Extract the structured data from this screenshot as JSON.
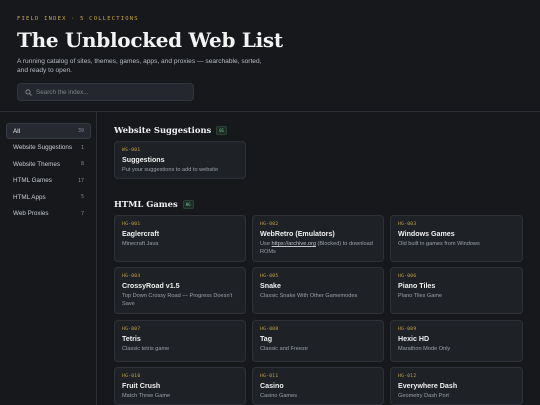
{
  "header": {
    "eyebrow": "FIELD INDEX · 5 COLLECTIONS",
    "title": "The Unblocked Web List",
    "subtitle": "A running catalog of sites, themes, games, apps, and proxies — searchable, sorted, and ready to open."
  },
  "search": {
    "placeholder": "Search the index..."
  },
  "sidebar": {
    "items": [
      {
        "label": "All",
        "count": "39"
      },
      {
        "label": "Website Suggestions",
        "count": "1"
      },
      {
        "label": "Website Themes",
        "count": "8"
      },
      {
        "label": "HTML Games",
        "count": "17"
      },
      {
        "label": "HTML Apps",
        "count": "5"
      },
      {
        "label": "Web Proxies",
        "count": "7"
      }
    ]
  },
  "sections": [
    {
      "title": "Website Suggestions",
      "badge": "01",
      "cards": [
        {
          "code": "WS-001",
          "name": "Suggestions",
          "desc": "Put your suggestions to add to website"
        }
      ]
    },
    {
      "title": "HTML Games",
      "badge": "HG",
      "cards": [
        {
          "code": "HG-001",
          "name": "Eaglercraft",
          "desc": "Minecraft Java"
        },
        {
          "code": "HG-002",
          "name": "WebRetro (Emulators)",
          "desc_pre": "Use ",
          "desc_link": "https://archive.org",
          "desc_post": " (Blocked) to download ROMs"
        },
        {
          "code": "HG-003",
          "name": "Windows Games",
          "desc": "Old built in games from Windows"
        },
        {
          "code": "HG-004",
          "name": "CrossyRoad v1.5",
          "desc": "Top Down Crossy Road — Progress Doesn't Save"
        },
        {
          "code": "HG-005",
          "name": "Snake",
          "desc": "Classic Snake With Other Gamemodes"
        },
        {
          "code": "HG-006",
          "name": "Piano Tiles",
          "desc": "Piano Tiles Game"
        },
        {
          "code": "HG-007",
          "name": "Tetris",
          "desc": "Classic tetris game"
        },
        {
          "code": "HG-008",
          "name": "Tag",
          "desc": "Classic and Freeze"
        },
        {
          "code": "HG-009",
          "name": "Hexic HD",
          "desc": "Marathon Mode Only"
        },
        {
          "code": "HG-010",
          "name": "Fruit Crush",
          "desc": "Match Three Game"
        },
        {
          "code": "HG-011",
          "name": "Casino",
          "desc": "Casino Games"
        },
        {
          "code": "HG-012",
          "name": "Everywhere Dash",
          "desc": "Geometry Dash Port"
        }
      ]
    }
  ]
}
